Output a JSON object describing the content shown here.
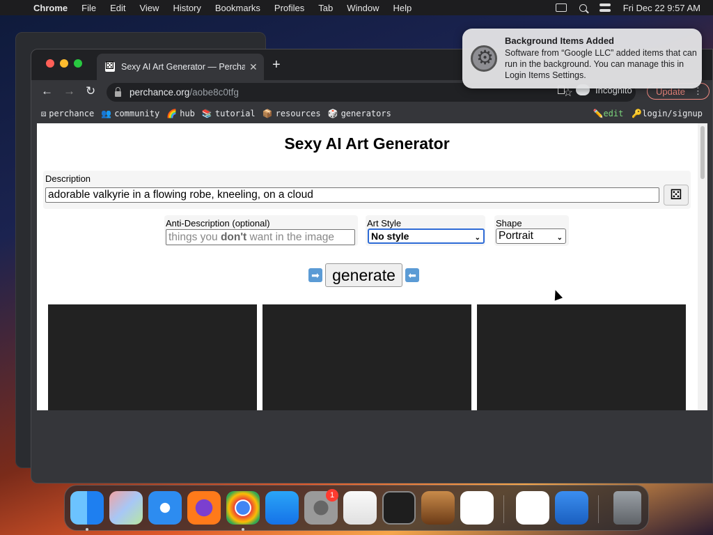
{
  "menubar": {
    "app": "Chrome",
    "items": [
      "File",
      "Edit",
      "View",
      "History",
      "Bookmarks",
      "Profiles",
      "Tab",
      "Window",
      "Help"
    ],
    "datetime": "Fri Dec 22  9:57 AM"
  },
  "browser": {
    "tab_title": "Sexy AI Art Generator — Perchance",
    "url_host": "perchance.org",
    "url_path": "/aobe8c0tfg",
    "incognito_label": "Incognito",
    "update_label": "Update"
  },
  "bookmarks": {
    "items": [
      {
        "icon": "⚄",
        "label": "perchance"
      },
      {
        "icon": "👥",
        "label": "community"
      },
      {
        "icon": "🌈",
        "label": "hub"
      },
      {
        "icon": "📚",
        "label": "tutorial"
      },
      {
        "icon": "📦",
        "label": "resources"
      },
      {
        "icon": "🎲",
        "label": "generators"
      }
    ],
    "edit": {
      "icon": "✏️",
      "label": "edit"
    },
    "login": {
      "icon": "🔑",
      "label": "login/signup"
    }
  },
  "page": {
    "title": "Sexy AI Art Generator",
    "description_label": "Description",
    "description_value": "adorable valkyrie in a flowing robe, kneeling, on a cloud",
    "anti_label": "Anti-Description (optional)",
    "anti_placeholder_pre": "things you ",
    "anti_placeholder_bold": "don't",
    "anti_placeholder_post": " want in the image",
    "art_style_label": "Art Style",
    "art_style_value": "No style",
    "shape_label": "Shape",
    "shape_value": "Portrait",
    "generate_label": "generate"
  },
  "notification": {
    "title": "Background Items Added",
    "body": "Software from “Google LLC” added items that can run in the background. You can manage this in Login Items Settings."
  },
  "dock": {
    "system_settings_badge": "1"
  }
}
